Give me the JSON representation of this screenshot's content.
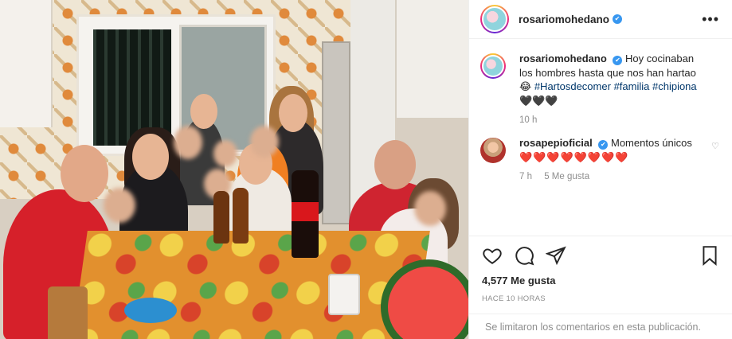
{
  "header": {
    "username": "rosariomohedano",
    "verified": true,
    "more_icon": "more-horizontal-icon"
  },
  "caption": {
    "username": "rosariomohedano",
    "text_prefix": "Hoy cocinaban los hombres hasta que nos han hartao",
    "emoji": "😂",
    "hashtags": [
      "#Hartosdecomer",
      "#familia",
      "#chipiona"
    ],
    "trailing": "🖤🖤🖤",
    "time": "10 h"
  },
  "comments": [
    {
      "username": "rosapepioficial",
      "verified": true,
      "text": "Momentos únicos",
      "hearts": "❤️❤️❤️❤️❤️❤️❤️❤️",
      "time": "7 h",
      "likes": "5 Me gusta"
    }
  ],
  "actions": {
    "icons": [
      "heart-icon",
      "comment-icon",
      "share-icon",
      "bookmark-icon"
    ],
    "likes": "4,577 Me gusta",
    "timestamp": "HACE 10 HORAS"
  },
  "footer": {
    "comments_disabled": "Se limitaron los comentarios en esta publicación."
  },
  "colors": {
    "link": "#00376b",
    "muted": "#8e8e8e",
    "verified": "#3897f0",
    "heart": "#e0245e"
  }
}
